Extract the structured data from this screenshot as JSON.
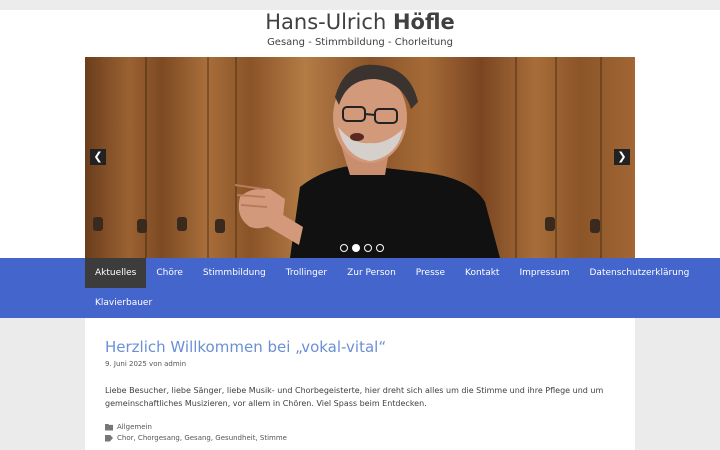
{
  "site": {
    "title_first": "Hans-Ulrich",
    "title_last": "Höfle",
    "description": "Gesang - Stimmbildung - Chorleitung"
  },
  "slider": {
    "prev_icon": "chevron-left-icon",
    "next_icon": "chevron-right-icon",
    "prev_glyph": "❮",
    "next_glyph": "❯",
    "dot_count": 4,
    "active_dot": 2
  },
  "nav": {
    "items": [
      {
        "label": "Aktuelles",
        "active": true
      },
      {
        "label": "Chöre"
      },
      {
        "label": "Stimmbildung"
      },
      {
        "label": "Trollinger"
      },
      {
        "label": "Zur Person"
      },
      {
        "label": "Presse"
      },
      {
        "label": "Kontakt"
      },
      {
        "label": "Impressum"
      },
      {
        "label": "Datenschutzerklärung"
      },
      {
        "label": "Klavierbauer"
      }
    ]
  },
  "post": {
    "title": "Herzlich Willkommen bei „vokal-vital“",
    "meta": "9. Juni 2025 von admin",
    "excerpt": "Liebe Besucher, liebe Sänger, liebe Musik- und Chorbegeisterte, hier dreht sich alles um die Stimme und ihre Pflege und um gemeinschaftliches Musizieren, vor allem in Chören. Viel Spass beim Entdecken.",
    "category": "Allgemein",
    "tags": "Chor, Chorgesang, Gesang, Gesundheit, Stimme"
  },
  "colors": {
    "nav_bg": "#4466cc",
    "nav_active": "#3c3c3c",
    "title_link": "#6b8fd6"
  }
}
